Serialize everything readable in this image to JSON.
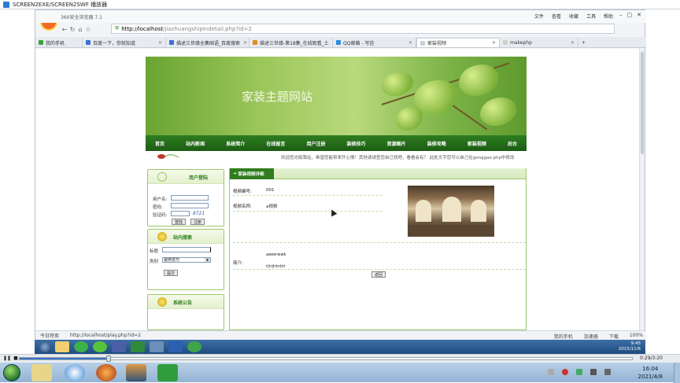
{
  "player": {
    "title": "SCREEN2EXE/SCREEN2SWF 播放器",
    "time": "0:29/3:20"
  },
  "browser": {
    "name": "360安全浏览器 7.1",
    "logo_text": "NEW",
    "menu": [
      "文件",
      "查看",
      "收藏",
      "工具",
      "帮助"
    ],
    "address": {
      "host": "http://localhost",
      "path": "/jiazhuangshipindetail.php?id=2"
    },
    "tabs": [
      {
        "label": "我的手机",
        "color": "#3aa33a"
      },
      {
        "label": "百度一下，你就知道",
        "color": "#3b6fd1"
      },
      {
        "label": "描述三世缘全集国语_百度搜索",
        "color": "#3b6fd1"
      },
      {
        "label": "描述三世缘-第18集_在线观看_土",
        "color": "#e08a1f"
      },
      {
        "label": "QQ邮箱 - 写信",
        "color": "#2d8ee0"
      },
      {
        "label": "家装视频",
        "color": "#aaaaaa"
      },
      {
        "label": "makephp",
        "color": "#aaaaaa"
      }
    ],
    "status": {
      "today": "今日特卖",
      "url": "http://localhost/play.php?id=2",
      "right": [
        "我的手机",
        "加速器",
        "下载",
        "100%"
      ]
    }
  },
  "site": {
    "banner_title": "家装主题网站",
    "nav": [
      "首页",
      "站内新闻",
      "系统简介",
      "在线留言",
      "用户注册",
      "装修技巧",
      "资源图片",
      "装修攻略",
      "家装视频",
      "后台"
    ],
    "marquee": "欢迎您光临我站，希望您能带来开心情！其他请请查您自己找吧，看看会有？ 此处文字您可以自己在gonggao.php中修改",
    "login": {
      "title": "用户登陆",
      "username_label": "用户名:",
      "password_label": "密码:",
      "captcha_label": "验证码:",
      "captcha_code": "8721",
      "login_btn": "登陆",
      "register_btn": "注册"
    },
    "search": {
      "title": "站内搜索",
      "keyword_label": "标题",
      "category_label": "类别",
      "category_value": "装修技巧",
      "submit_btn": "提交"
    },
    "notice": {
      "title": "系统公告"
    },
    "detail": {
      "tab_title": "家装视频详细",
      "video_no_label": "视频编号:",
      "video_no": "001",
      "video_title_label": "视频名称:",
      "video_title": "a视频",
      "intro_label": "简介:",
      "intro_line1": "aeeerwwk",
      "intro_line2": "rjtrjtrkrktr",
      "back_btn": "返回"
    }
  },
  "taskbar": {
    "inner_time": "9:45",
    "inner_date": "2015/11/6",
    "outer_time": "16:04",
    "outer_date": "2021/4/8"
  },
  "colors": {
    "nav_green": "#2e7d21",
    "accent_blue": "#3a74c6"
  }
}
